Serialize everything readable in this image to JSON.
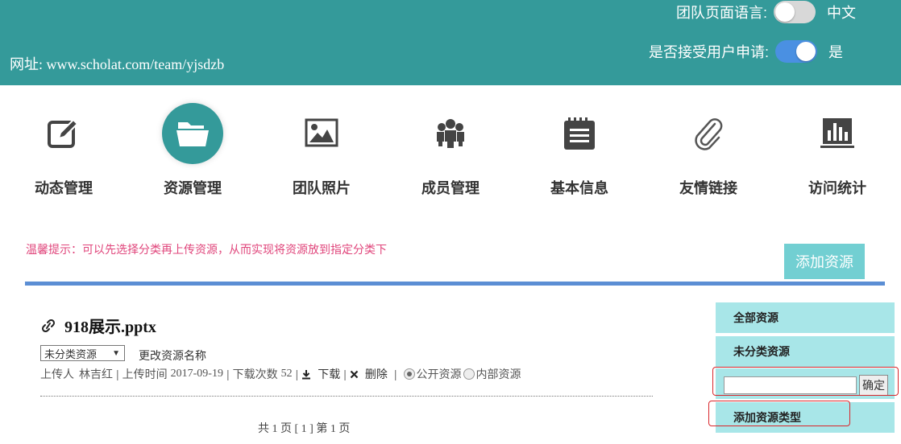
{
  "header": {
    "url_text": "网址: www.scholat.com/team/yjsdzb",
    "language_label": "团队页面语言:",
    "language_value": "中文",
    "language_toggle_on": false,
    "apply_label": "是否接受用户申请:",
    "apply_value": "是",
    "apply_toggle_on": true
  },
  "nav": {
    "items": [
      {
        "label": "动态管理",
        "icon": "edit-icon",
        "active": false
      },
      {
        "label": "资源管理",
        "icon": "folder-open-icon",
        "active": true
      },
      {
        "label": "团队照片",
        "icon": "image-icon",
        "active": false
      },
      {
        "label": "成员管理",
        "icon": "group-icon",
        "active": false
      },
      {
        "label": "基本信息",
        "icon": "notepad-icon",
        "active": false
      },
      {
        "label": "友情链接",
        "icon": "paperclip-icon",
        "active": false
      },
      {
        "label": "访问统计",
        "icon": "bar-chart-icon",
        "active": false
      }
    ]
  },
  "tip": "温馨提示：可以先选择分类再上传资源，从而实现将资源放到指定分类下",
  "add_resource_label": "添加资源",
  "resource": {
    "title": "918展示.pptx",
    "category_selected": "未分类资源",
    "rename_label": "更改资源名称",
    "uploader_label": "上传人",
    "uploader": "林吉红",
    "upload_time_label": "上传时间",
    "upload_time": "2017-09-19",
    "downloads_label": "下载次数",
    "downloads": "52",
    "download_label": "下载",
    "delete_label": "删除",
    "public_label": "公开资源",
    "internal_label": "内部资源",
    "visibility": "public"
  },
  "pager": {
    "text": "共 1 页 [ 1 ] 第 1 页"
  },
  "sidebar": {
    "all_label": "全部资源",
    "uncategorized_label": "未分类资源",
    "input_value": "",
    "confirm_label": "确定",
    "add_type_label": "添加资源类型"
  },
  "colors": {
    "header_bg": "#349a9a",
    "tip": "#e0457b",
    "add_button": "#72cfd2",
    "rule": "#5b8ed4",
    "sidebar_bg": "#a8e6e8",
    "highlight_box": "#d9252a",
    "toggle_on": "#4a90e2"
  }
}
